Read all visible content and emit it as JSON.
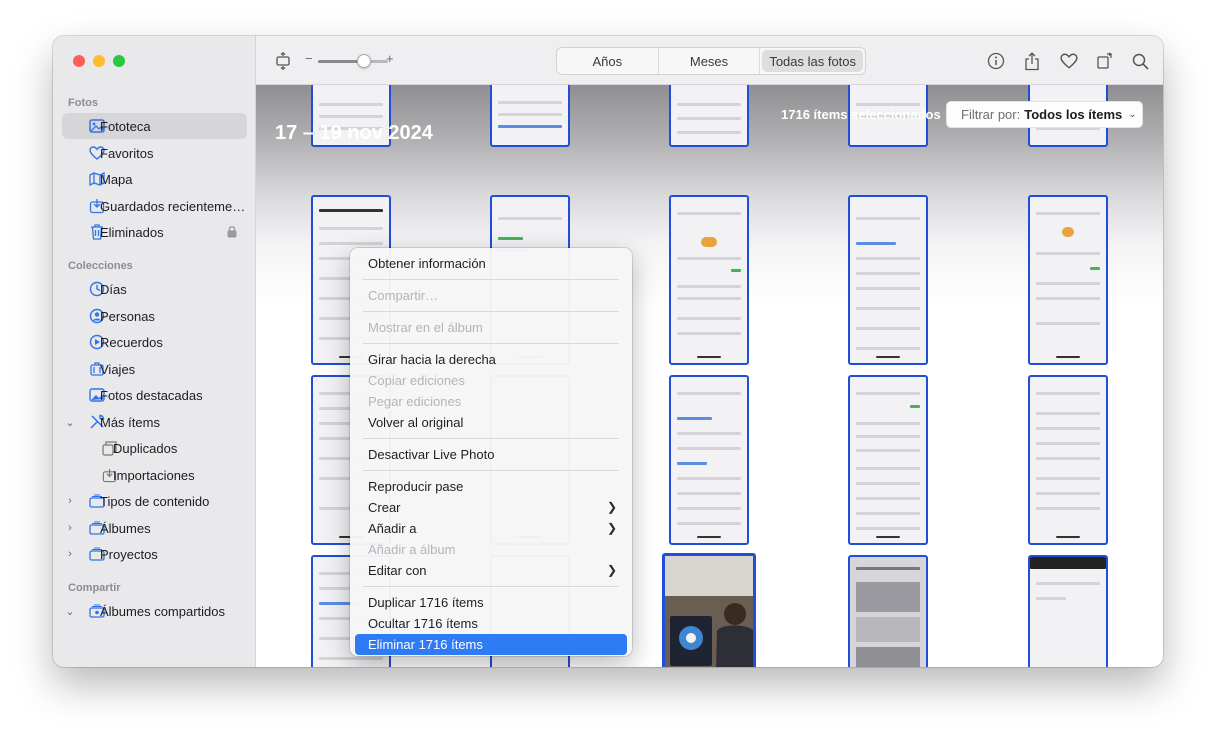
{
  "toolbar": {
    "tabs": [
      "Años",
      "Meses",
      "Todas las fotos"
    ],
    "zoom_minus": "−",
    "zoom_plus": "+",
    "zoom_level": 0.64
  },
  "sidebar": {
    "section_fotos": "Fotos",
    "section_colecciones": "Colecciones",
    "section_compartir": "Compartir",
    "fotos_items": [
      {
        "label": "Fototeca",
        "icon": "photo-library-icon"
      },
      {
        "label": "Favoritos",
        "icon": "heart-icon"
      },
      {
        "label": "Mapa",
        "icon": "map-icon"
      },
      {
        "label": "Guardados recienteme…",
        "icon": "import-icon"
      },
      {
        "label": "Eliminados",
        "icon": "trash-icon"
      }
    ],
    "coleccion_items": [
      {
        "label": "Días",
        "icon": "clock-icon"
      },
      {
        "label": "Personas",
        "icon": "person-icon"
      },
      {
        "label": "Recuerdos",
        "icon": "memories-icon"
      },
      {
        "label": "Viajes",
        "icon": "travel-icon"
      },
      {
        "label": "Fotos destacadas",
        "icon": "featured-icon"
      },
      {
        "label": "Más ítems",
        "icon": "tools-icon"
      },
      {
        "label": "Duplicados",
        "icon": "duplicate-icon"
      },
      {
        "label": "Importaciones",
        "icon": "import-icon"
      },
      {
        "label": "Tipos de contenido",
        "icon": "folder-stack-icon"
      },
      {
        "label": "Álbumes",
        "icon": "folder-stack-icon"
      },
      {
        "label": "Proyectos",
        "icon": "folder-stack-icon"
      }
    ],
    "compartir_items": [
      {
        "label": "Álbumes compartidos",
        "icon": "shared-album-icon"
      }
    ]
  },
  "content": {
    "date_range": "17 – 19 nov 2024",
    "selection_count": "1716 ítems seleccionados",
    "filter_label": "Filtrar por:",
    "filter_value": "Todos los ítems"
  },
  "context_menu": [
    {
      "label": "Obtener información",
      "enabled": true
    },
    {
      "sep": true
    },
    {
      "label": "Compartir…",
      "enabled": false
    },
    {
      "sep": true
    },
    {
      "label": "Mostrar en el álbum",
      "enabled": false
    },
    {
      "sep": true
    },
    {
      "label": "Girar hacia la derecha",
      "enabled": true
    },
    {
      "label": "Copiar ediciones",
      "enabled": false
    },
    {
      "label": "Pegar ediciones",
      "enabled": false
    },
    {
      "label": "Volver al original",
      "enabled": true
    },
    {
      "sep": true
    },
    {
      "label": "Desactivar Live Photo",
      "enabled": true
    },
    {
      "sep": true
    },
    {
      "label": "Reproducir pase",
      "enabled": true
    },
    {
      "label": "Crear",
      "enabled": true,
      "submenu": true
    },
    {
      "label": "Añadir a",
      "enabled": true,
      "submenu": true
    },
    {
      "label": "Añadir a álbum",
      "enabled": false
    },
    {
      "label": "Editar con",
      "enabled": true,
      "submenu": true
    },
    {
      "sep": true
    },
    {
      "label": "Duplicar 1716 ítems",
      "enabled": true
    },
    {
      "label": "Ocultar 1716 ítems",
      "enabled": true
    },
    {
      "label": "Eliminar 1716 ítems",
      "enabled": true,
      "highlighted": true
    }
  ],
  "colors": {
    "selection_border": "#1f4fd6",
    "menu_highlight": "#2f7bf5",
    "sidebar_icon": "#2f74e8"
  }
}
